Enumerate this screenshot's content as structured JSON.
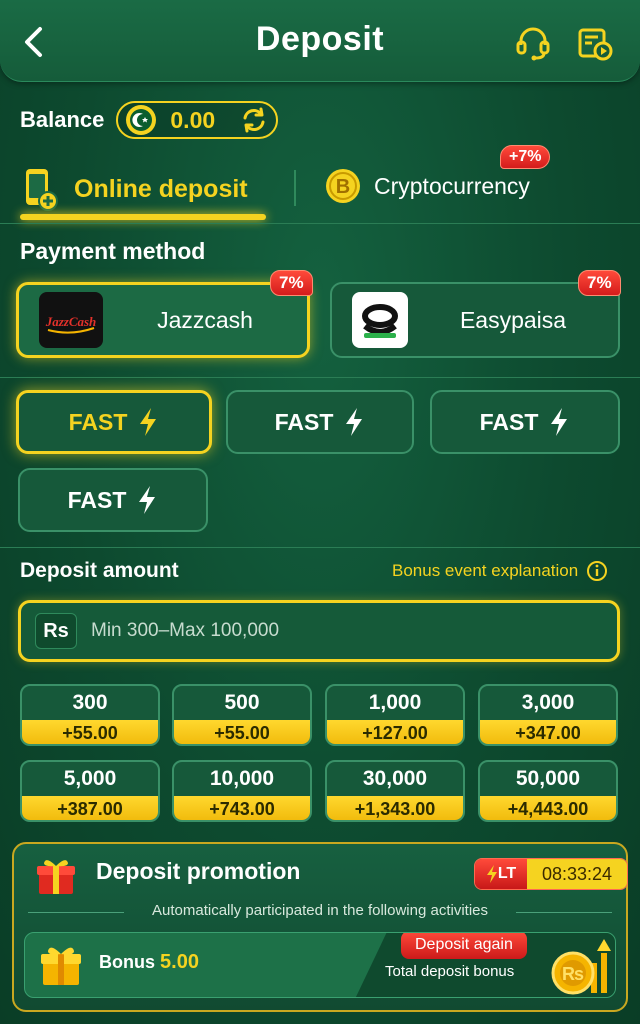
{
  "header": {
    "title": "Deposit",
    "back_icon": "back-icon",
    "support_icon": "headset-icon",
    "history_icon": "history-icon"
  },
  "balance": {
    "label": "Balance",
    "value": "0.00",
    "currency_icon": "pakistan-flag-icon",
    "refresh_icon": "refresh-icon"
  },
  "tabs": [
    {
      "label": "Online deposit",
      "icon": "phone-deposit-icon",
      "active": true
    },
    {
      "label": "Cryptocurrency",
      "icon": "bitcoin-icon",
      "badge": "+7%",
      "active": false
    }
  ],
  "payment": {
    "title": "Payment method",
    "methods": [
      {
        "name": "Jazzcash",
        "logo_text": "JazzCash",
        "badge": "7%",
        "selected": true
      },
      {
        "name": "Easypaisa",
        "badge": "7%",
        "selected": false
      }
    ],
    "channels": [
      {
        "label": "FAST",
        "selected": true
      },
      {
        "label": "FAST",
        "selected": false
      },
      {
        "label": "FAST",
        "selected": false
      },
      {
        "label": "FAST",
        "selected": false
      }
    ]
  },
  "deposit": {
    "title": "Deposit amount",
    "bonus_link": "Bonus event explanation",
    "currency_tag": "Rs",
    "placeholder": "Min 300–Max 100,000",
    "amounts": [
      {
        "value": "300",
        "bonus": "+55.00"
      },
      {
        "value": "500",
        "bonus": "+55.00"
      },
      {
        "value": "1,000",
        "bonus": "+127.00"
      },
      {
        "value": "3,000",
        "bonus": "+347.00"
      },
      {
        "value": "5,000",
        "bonus": "+387.00"
      },
      {
        "value": "10,000",
        "bonus": "+743.00"
      },
      {
        "value": "30,000",
        "bonus": "+1,343.00"
      },
      {
        "value": "50,000",
        "bonus": "+4,443.00"
      }
    ]
  },
  "promotion": {
    "title": "Deposit promotion",
    "timer_tag": "LT",
    "timer": "08:33:24",
    "subtitle": "Automatically participated in the following activities",
    "activity": {
      "bonus_label": "Bonus",
      "bonus_value": "5.00",
      "button": "Deposit again",
      "description": "Total deposit bonus"
    }
  },
  "colors": {
    "accent": "#f5d320",
    "badge": "#e02a20",
    "background": "#0d4a2f"
  }
}
